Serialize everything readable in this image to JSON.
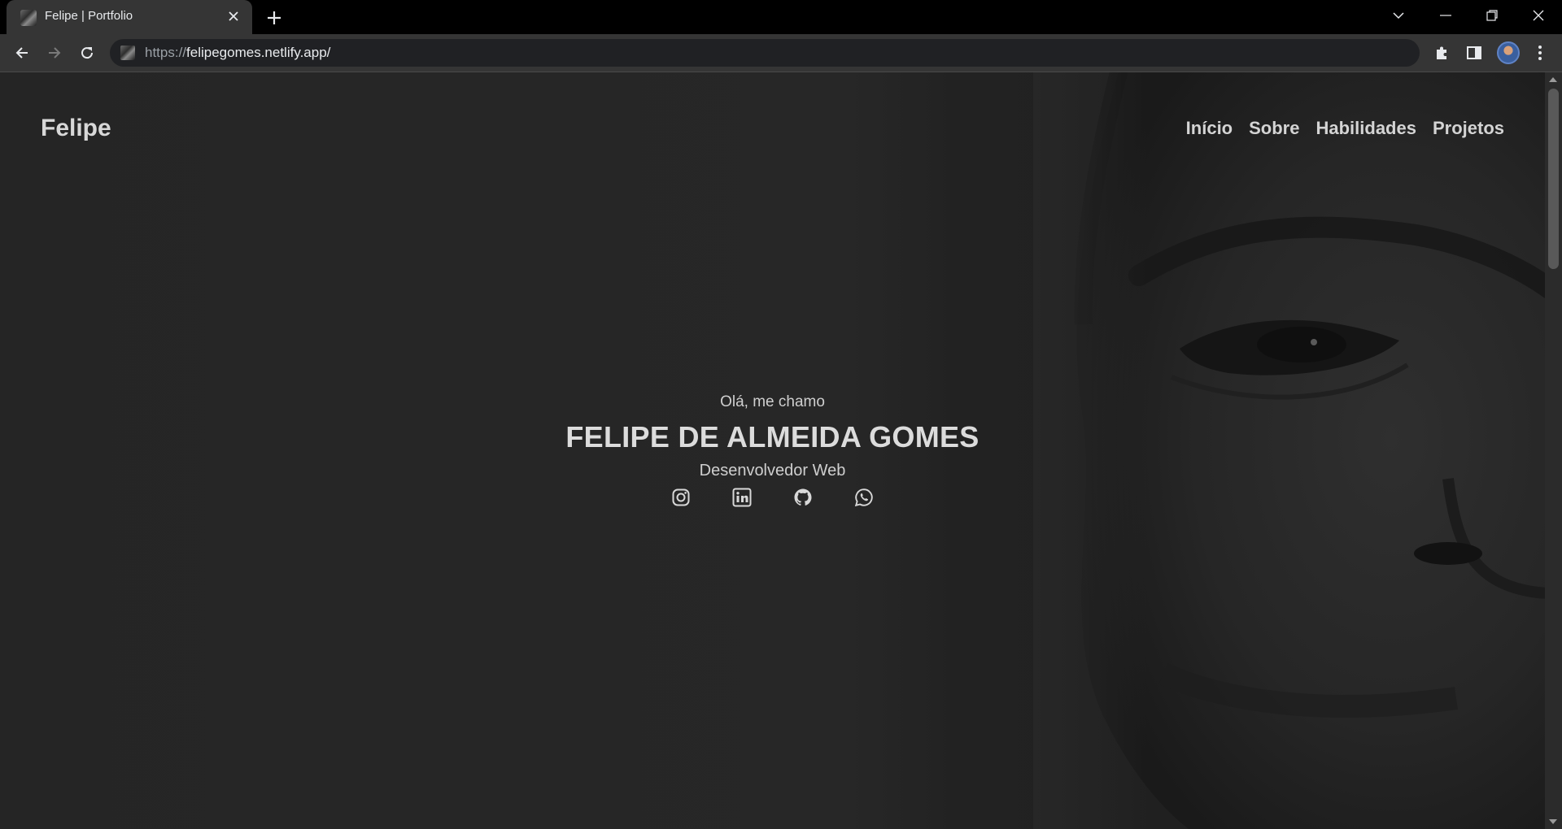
{
  "browser": {
    "tab_title": "Felipe | Portfolio",
    "url_scheme": "https://",
    "url_host": "felipegomes.netlify.app/"
  },
  "site": {
    "logo": "Felipe",
    "nav": [
      "Início",
      "Sobre",
      "Habilidades",
      "Projetos"
    ]
  },
  "hero": {
    "greeting": "Olá, me chamo",
    "name": "FELIPE DE ALMEIDA GOMES",
    "role": "Desenvolvedor Web",
    "social_icons": [
      "instagram-icon",
      "linkedin-icon",
      "github-icon",
      "whatsapp-icon"
    ]
  },
  "colors": {
    "background": "#262626",
    "text": "#d8d8d8",
    "chrome": "#353535"
  }
}
